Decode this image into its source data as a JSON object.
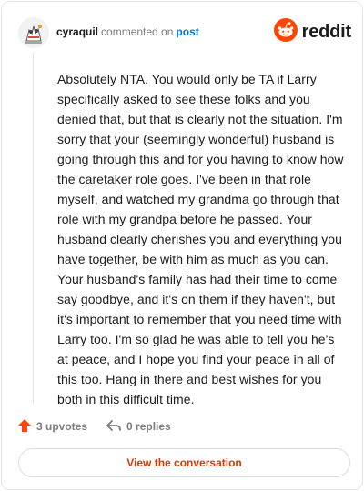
{
  "header": {
    "username": "cyraquil",
    "action_text": "commented on",
    "post_link": "post",
    "brand": "reddit",
    "icons": {
      "avatar": "user-avatar-icon",
      "brand": "reddit-snoo-icon"
    }
  },
  "comment": {
    "body": "Absolutely NTA. You would only be TA if Larry specifically asked to see these folks and you denied that, but that is clearly not the situation. I'm sorry that your (seemingly wonderful) husband is going through this and for you having to know how the caretaker role goes. I've been in that role myself, and watched my grandma go through that role with my grandpa before he passed. Your husband clearly cherishes you and everything you have together, be with him as much as you can. Your husband's family has had their time to come say goodbye, and it's on them if they haven't, but it's important to remember that you need time with Larry too. I'm so glad he was able to tell you he's at peace, and I hope you find your peace in all of this too. Hang in there and best wishes for you both in this difficult time."
  },
  "footer": {
    "upvotes": "3 upvotes",
    "replies": "0 replies",
    "icons": {
      "upvote": "upvote-arrow-icon",
      "reply": "reply-arrow-icon"
    }
  },
  "cta": {
    "label": "View the conversation"
  },
  "colors": {
    "accent": "#d93a00",
    "link": "#0079d3",
    "upvote": "#ff4500",
    "muted": "#7c7c7c"
  }
}
